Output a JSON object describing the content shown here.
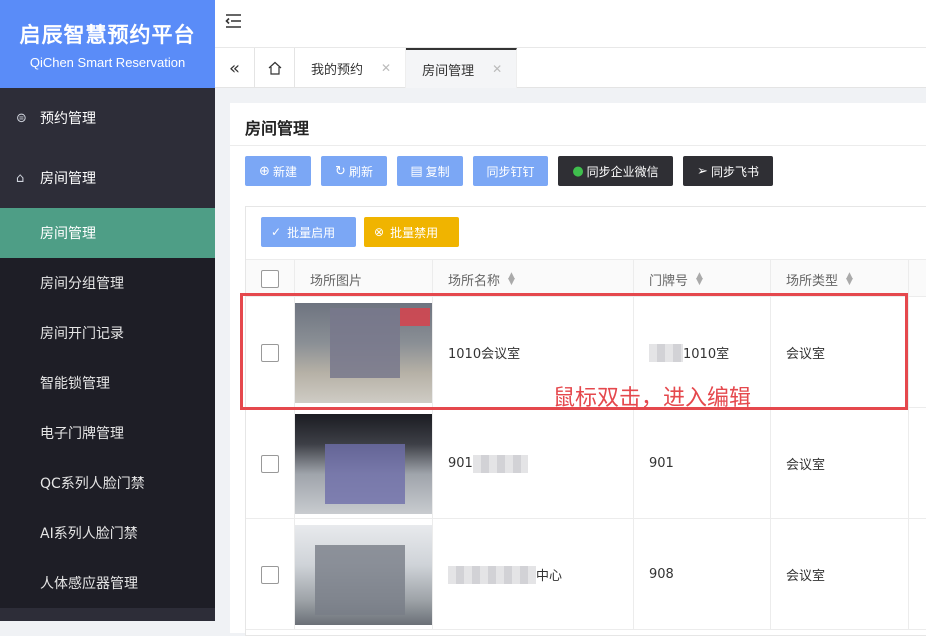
{
  "brand": {
    "title": "启辰智慧预约平台",
    "subtitle": "QiChen Smart Reservation"
  },
  "sidebar": {
    "groups": [
      {
        "label": "预约管理",
        "icon": "link-icon"
      },
      {
        "label": "房间管理",
        "icon": "home-icon"
      }
    ],
    "items": [
      {
        "label": "房间管理",
        "active": true
      },
      {
        "label": "房间分组管理"
      },
      {
        "label": "房间开门记录"
      },
      {
        "label": "智能锁管理"
      },
      {
        "label": "电子门牌管理"
      },
      {
        "label": "QC系列人脸门禁"
      },
      {
        "label": "AI系列人脸门禁"
      },
      {
        "label": "人体感应器管理"
      }
    ]
  },
  "tabs": [
    {
      "label": "我的预约"
    },
    {
      "label": "房间管理",
      "active": true
    }
  ],
  "page": {
    "title": "房间管理"
  },
  "toolbar": {
    "new": "新建",
    "refresh": "刷新",
    "copy": "复制",
    "sync_ding": "同步钉钉",
    "sync_wechat": "同步企业微信",
    "sync_feishu": "同步飞书"
  },
  "batch": {
    "enable": "批量启用",
    "disable": "批量禁用"
  },
  "table": {
    "headers": [
      "场所图片",
      "场所名称",
      "门牌号",
      "场所类型"
    ],
    "rows": [
      {
        "name": "1010会议室",
        "door": "1010室",
        "type": "会议室"
      },
      {
        "name": "901",
        "door": "901",
        "type": "会议室"
      },
      {
        "name": "中心",
        "door": "908",
        "type": "会议室"
      }
    ]
  },
  "annotation": {
    "hint": "鼠标双击，进入编辑"
  },
  "colors": {
    "brand": "#5a8cf8",
    "active_menu": "#4e9e86",
    "highlight": "#e5484d",
    "disable_btn": "#f0b400"
  }
}
